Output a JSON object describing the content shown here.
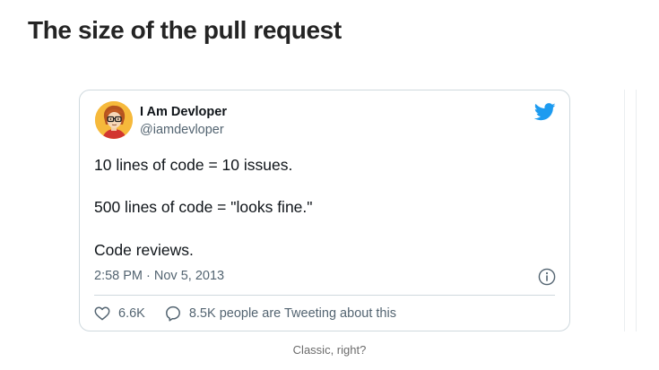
{
  "article": {
    "heading": "The size of the pull request",
    "caption": "Classic, right?"
  },
  "tweet": {
    "author_name": "I Am Devloper",
    "author_handle": "@iamdevloper",
    "lines": [
      "10 lines of code = 10 issues.",
      "500 lines of code = \"looks fine.\"",
      "Code reviews."
    ],
    "timestamp": "2:58 PM · Nov 5, 2013",
    "likes": "6.6K",
    "discussion": "8.5K people are Tweeting about this",
    "icons": {
      "brand": "twitter-bird-icon",
      "info": "info-icon",
      "like": "heart-icon",
      "reply": "speech-bubble-icon"
    },
    "colors": {
      "brand_blue": "#1d9bf0",
      "text": "#0f1419",
      "secondary": "#536471",
      "border": "#cfd9de",
      "avatar_background": "#f6b93b"
    }
  }
}
